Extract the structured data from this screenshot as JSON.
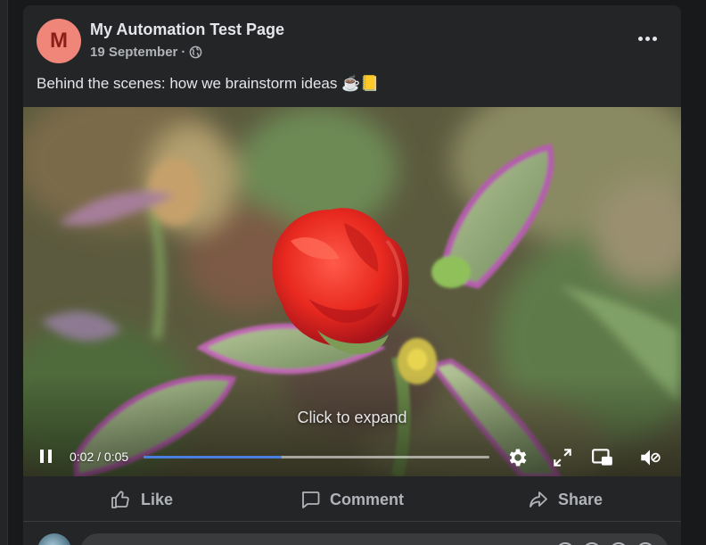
{
  "post": {
    "avatar_letter": "M",
    "page_name": "My Automation Test Page",
    "date": "19 September",
    "separator": "·",
    "privacy_icon": "globe-icon",
    "more_icon": "more-options-icon",
    "text": "Behind the scenes: how we brainstorm ideas ☕📒"
  },
  "video": {
    "expand_hint": "Click to expand",
    "time_readout": "0:02 / 0:05",
    "progress_fraction": 0.4,
    "icons": {
      "play_pause": "pause-icon",
      "settings": "gear-icon",
      "fullscreen": "expand-icon",
      "picture_in_picture": "pip-icon",
      "volume": "volume-muted-icon"
    }
  },
  "actions": {
    "like": {
      "label": "Like",
      "icon": "thumbs-up-icon"
    },
    "comment": {
      "label": "Comment",
      "icon": "comment-icon"
    },
    "share": {
      "label": "Share",
      "icon": "share-icon"
    }
  },
  "colors": {
    "background": "#18191a",
    "card": "#242526",
    "primary_text": "#e4e6eb",
    "secondary_text": "#b0b3b8",
    "avatar": "#f0857a",
    "progress": "#4a7fe0"
  }
}
